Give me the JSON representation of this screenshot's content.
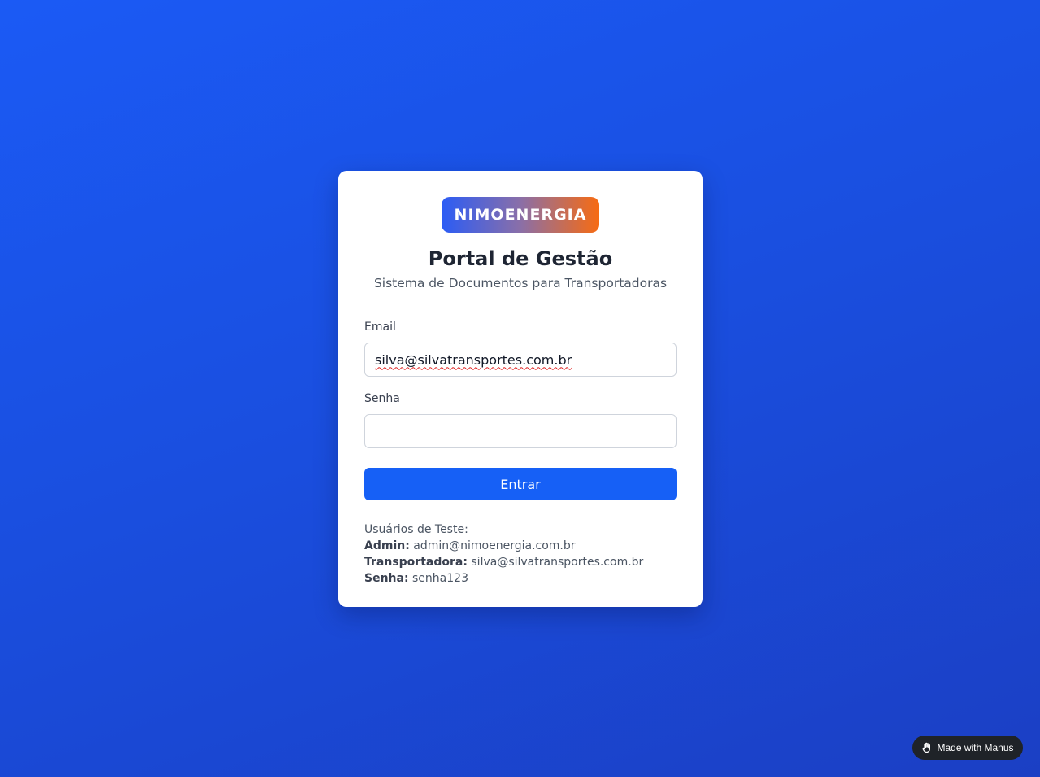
{
  "brand": {
    "logo_text": "NIMOENERGIA"
  },
  "header": {
    "title": "Portal de Gestão",
    "subtitle": "Sistema de Documentos para Transportadoras"
  },
  "form": {
    "email_label": "Email",
    "email_value": "silva@silvatransportes.com.br",
    "password_label": "Senha",
    "password_value": "",
    "submit_label": "Entrar"
  },
  "test_users": {
    "heading": "Usuários de Teste:",
    "admin_label": "Admin:",
    "admin_value": "admin@nimoenergia.com.br",
    "carrier_label": "Transportadora:",
    "carrier_value": "silva@silvatransportes.com.br",
    "password_label": "Senha:",
    "password_value": "senha123"
  },
  "footer_badge": {
    "icon": "manus-hand-icon",
    "label": "Made with Manus"
  },
  "colors": {
    "background": "#1b4fe0",
    "primary_button": "#1660f6",
    "logo_gradient_start": "#2b5cf5",
    "logo_gradient_end": "#f76b12"
  }
}
